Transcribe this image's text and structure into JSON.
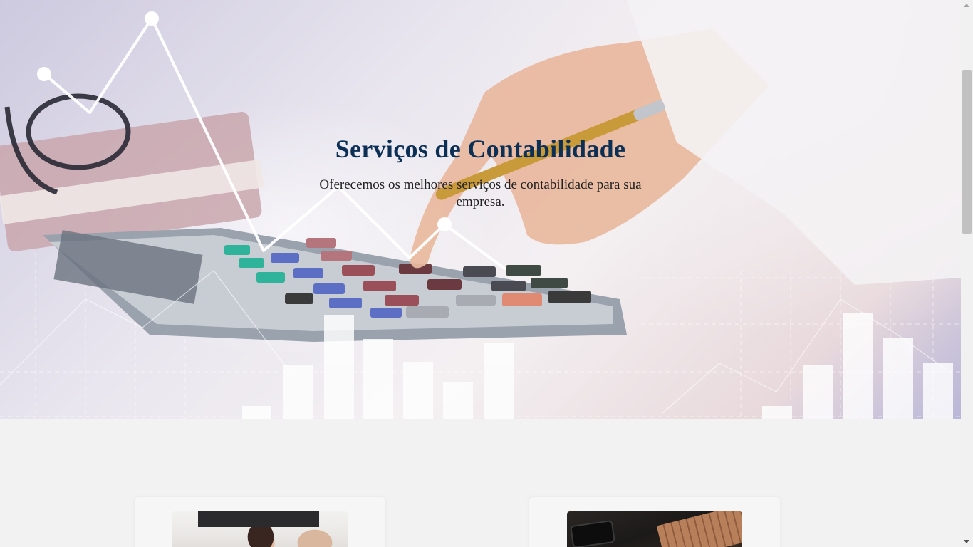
{
  "hero": {
    "title": "Serviços de Contabilidade",
    "subtitle": "Oferecemos os melhores serviços de contabilidade para sua empresa.",
    "image_description_icon": "calculator-chart-photo"
  },
  "cards": [
    {
      "image_icon": "team-meeting-photo"
    },
    {
      "image_icon": "desk-keyboard-phone-photo"
    }
  ],
  "colors": {
    "title": "#0c2f55",
    "page_background": "#f2f2f2"
  }
}
